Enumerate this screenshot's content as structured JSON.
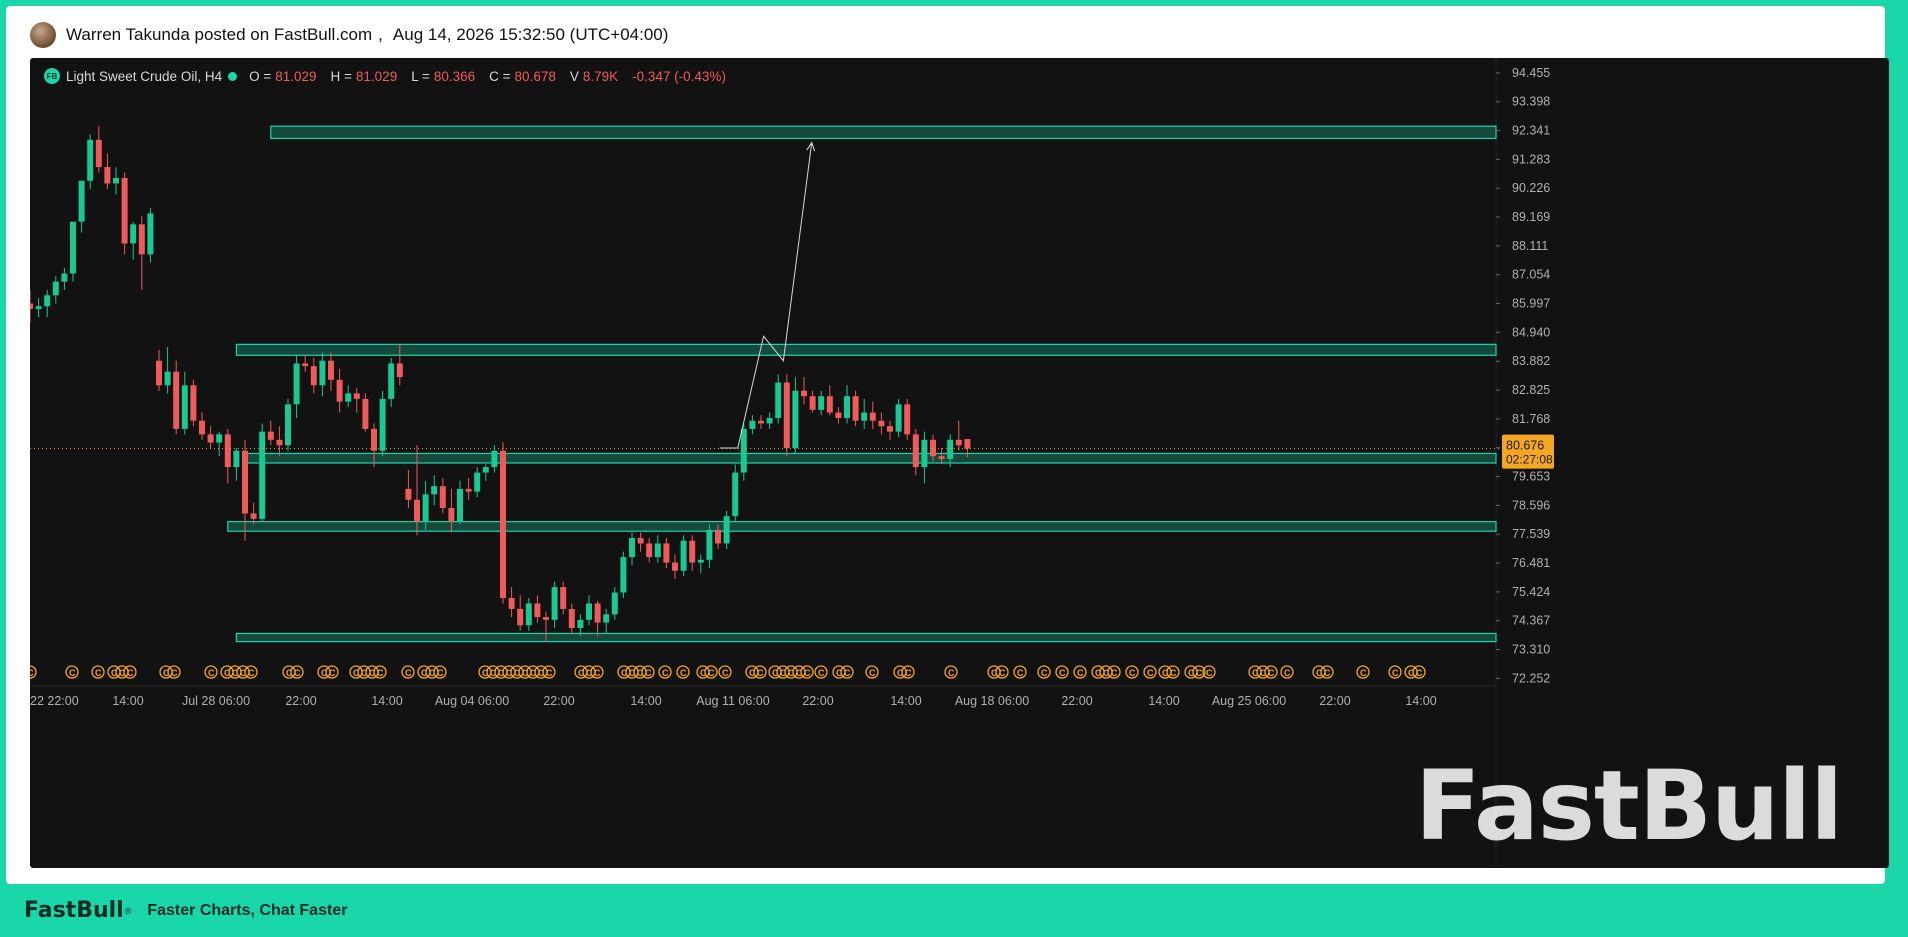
{
  "post": {
    "author": "Warren Takunda posted on FastBull.com",
    "separator": ",",
    "datetime": "Aug 14, 2026 15:32:50 (UTC+04:00)"
  },
  "legend": {
    "symbol": "Light Sweet Crude Oil, H4",
    "o_label": "O =",
    "o_value": "81.029",
    "h_label": "H =",
    "h_value": "81.029",
    "l_label": "L =",
    "l_value": "80.366",
    "c_label": "C =",
    "c_value": "80.678",
    "v_label": "V",
    "v_value": "8.79K",
    "change": "-0.347 (-0.43%)"
  },
  "watermark": "FastBull",
  "footer": {
    "brand": "FastBull",
    "reg": "®",
    "slogan": "Faster Charts, Chat Faster"
  },
  "colors": {
    "up": "#19c892",
    "down": "#f05a5a",
    "zone": "#19d7a8",
    "background": "#121212",
    "price_tag": "#f5a623",
    "event_icon": "#f5a623"
  },
  "chart_data": {
    "type": "candlestick",
    "y_ticks": [
      "94.455",
      "93.398",
      "92.341",
      "91.283",
      "90.226",
      "89.169",
      "88.111",
      "87.054",
      "85.997",
      "84.940",
      "83.882",
      "82.825",
      "81.768",
      "80.711",
      "79.653",
      "78.596",
      "77.539",
      "76.481",
      "75.424",
      "74.367",
      "73.310",
      "72.252"
    ],
    "x_ticks": [
      "22 22:00",
      "14:00",
      "Jul 28 06:00",
      "22:00",
      "14:00",
      "Aug 04 06:00",
      "22:00",
      "14:00",
      "Aug 11 06:00",
      "22:00",
      "14:00",
      "Aug 18 06:00",
      "22:00",
      "14:00",
      "Aug 25 06:00",
      "22:00",
      "14:00"
    ],
    "ylim": [
      71.9,
      95.0
    ],
    "last_price": {
      "value": "80.676",
      "countdown": "02:27:08"
    },
    "zones": [
      {
        "from_index": 28,
        "y_top": 92.5,
        "y_bottom": 92.05
      },
      {
        "from_index": 24,
        "y_top": 84.5,
        "y_bottom": 84.1
      },
      {
        "from_index": 25,
        "y_top": 80.5,
        "y_bottom": 80.15
      },
      {
        "from_index": 23,
        "y_top": 78.0,
        "y_bottom": 77.65
      },
      {
        "from_index": 24,
        "y_top": 73.9,
        "y_bottom": 73.6
      }
    ],
    "projection_path": [
      [
        80.2,
        80.7
      ],
      [
        82.3,
        80.7
      ],
      [
        85.3,
        84.8
      ],
      [
        87.6,
        83.9
      ],
      [
        90.9,
        91.9
      ]
    ],
    "candles": [
      {
        "o": 86.0,
        "h": 86.5,
        "l": 85.3,
        "c": 85.8
      },
      {
        "o": 85.8,
        "h": 86.2,
        "l": 85.5,
        "c": 85.9
      },
      {
        "o": 85.9,
        "h": 86.5,
        "l": 85.5,
        "c": 86.3
      },
      {
        "o": 86.3,
        "h": 87.0,
        "l": 86.0,
        "c": 86.8
      },
      {
        "o": 86.8,
        "h": 87.3,
        "l": 86.5,
        "c": 87.1
      },
      {
        "o": 87.1,
        "h": 88.5,
        "l": 86.8,
        "c": 89.0
      },
      {
        "o": 89.0,
        "h": 90.3,
        "l": 88.6,
        "c": 90.5
      },
      {
        "o": 90.5,
        "h": 92.2,
        "l": 90.2,
        "c": 92.0
      },
      {
        "o": 92.0,
        "h": 92.5,
        "l": 90.8,
        "c": 91.0
      },
      {
        "o": 91.0,
        "h": 91.5,
        "l": 90.2,
        "c": 90.4
      },
      {
        "o": 90.4,
        "h": 91.0,
        "l": 90.0,
        "c": 90.6
      },
      {
        "o": 90.6,
        "h": 90.8,
        "l": 87.8,
        "c": 88.2
      },
      {
        "o": 88.2,
        "h": 89.0,
        "l": 87.6,
        "c": 88.9
      },
      {
        "o": 88.9,
        "h": 89.2,
        "l": 86.5,
        "c": 87.8
      },
      {
        "o": 87.8,
        "h": 89.5,
        "l": 87.5,
        "c": 89.3
      },
      {
        "o": 83.9,
        "h": 84.3,
        "l": 82.8,
        "c": 83.0
      },
      {
        "o": 83.0,
        "h": 84.4,
        "l": 82.7,
        "c": 83.5
      },
      {
        "o": 83.5,
        "h": 83.9,
        "l": 81.2,
        "c": 81.4
      },
      {
        "o": 81.4,
        "h": 83.5,
        "l": 81.2,
        "c": 83.0
      },
      {
        "o": 83.0,
        "h": 83.2,
        "l": 81.5,
        "c": 81.7
      },
      {
        "o": 81.7,
        "h": 82.0,
        "l": 81.0,
        "c": 81.2
      },
      {
        "o": 81.2,
        "h": 81.5,
        "l": 80.7,
        "c": 80.9
      },
      {
        "o": 80.9,
        "h": 81.3,
        "l": 80.4,
        "c": 81.2
      },
      {
        "o": 81.2,
        "h": 81.4,
        "l": 79.4,
        "c": 80.0
      },
      {
        "o": 80.0,
        "h": 80.7,
        "l": 79.5,
        "c": 80.6
      },
      {
        "o": 80.6,
        "h": 81.0,
        "l": 77.3,
        "c": 78.3
      },
      {
        "o": 78.3,
        "h": 78.7,
        "l": 77.9,
        "c": 78.1
      },
      {
        "o": 78.1,
        "h": 81.6,
        "l": 78.0,
        "c": 81.3
      },
      {
        "o": 81.3,
        "h": 81.7,
        "l": 80.8,
        "c": 81.0
      },
      {
        "o": 81.0,
        "h": 81.5,
        "l": 80.4,
        "c": 80.8
      },
      {
        "o": 80.8,
        "h": 82.5,
        "l": 80.6,
        "c": 82.3
      },
      {
        "o": 82.3,
        "h": 84.1,
        "l": 81.8,
        "c": 83.8
      },
      {
        "o": 83.8,
        "h": 84.1,
        "l": 83.5,
        "c": 83.7
      },
      {
        "o": 83.7,
        "h": 84.0,
        "l": 82.7,
        "c": 83.0
      },
      {
        "o": 83.0,
        "h": 84.2,
        "l": 82.6,
        "c": 83.9
      },
      {
        "o": 83.9,
        "h": 84.2,
        "l": 82.8,
        "c": 83.2
      },
      {
        "o": 83.2,
        "h": 83.6,
        "l": 82.0,
        "c": 82.4
      },
      {
        "o": 82.4,
        "h": 83.0,
        "l": 82.2,
        "c": 82.7
      },
      {
        "o": 82.7,
        "h": 82.9,
        "l": 82.0,
        "c": 82.5
      },
      {
        "o": 82.5,
        "h": 82.7,
        "l": 81.3,
        "c": 81.4
      },
      {
        "o": 81.4,
        "h": 81.6,
        "l": 80.0,
        "c": 80.6
      },
      {
        "o": 80.6,
        "h": 82.8,
        "l": 80.4,
        "c": 82.5
      },
      {
        "o": 82.5,
        "h": 84.0,
        "l": 82.2,
        "c": 83.8
      },
      {
        "o": 83.8,
        "h": 84.5,
        "l": 83.0,
        "c": 83.3
      },
      {
        "o": 79.2,
        "h": 79.9,
        "l": 78.5,
        "c": 78.8
      },
      {
        "o": 78.8,
        "h": 80.8,
        "l": 77.5,
        "c": 78.0
      },
      {
        "o": 78.0,
        "h": 79.5,
        "l": 77.7,
        "c": 79.0
      },
      {
        "o": 79.0,
        "h": 79.7,
        "l": 78.6,
        "c": 79.3
      },
      {
        "o": 79.3,
        "h": 79.6,
        "l": 78.3,
        "c": 78.5
      },
      {
        "o": 78.5,
        "h": 79.2,
        "l": 77.6,
        "c": 78.0
      },
      {
        "o": 78.0,
        "h": 79.5,
        "l": 77.9,
        "c": 79.2
      },
      {
        "o": 79.2,
        "h": 79.6,
        "l": 78.8,
        "c": 79.1
      },
      {
        "o": 79.1,
        "h": 80.0,
        "l": 78.9,
        "c": 79.8
      },
      {
        "o": 79.8,
        "h": 80.1,
        "l": 79.5,
        "c": 80.0
      },
      {
        "o": 80.0,
        "h": 80.8,
        "l": 79.8,
        "c": 80.6
      },
      {
        "o": 80.6,
        "h": 80.9,
        "l": 75.0,
        "c": 75.2
      },
      {
        "o": 75.2,
        "h": 75.6,
        "l": 74.5,
        "c": 74.8
      },
      {
        "o": 74.8,
        "h": 75.3,
        "l": 74.0,
        "c": 74.2
      },
      {
        "o": 74.2,
        "h": 75.2,
        "l": 74.0,
        "c": 75.0
      },
      {
        "o": 75.0,
        "h": 75.3,
        "l": 74.3,
        "c": 74.5
      },
      {
        "o": 74.5,
        "h": 74.7,
        "l": 73.6,
        "c": 74.4
      },
      {
        "o": 74.4,
        "h": 75.8,
        "l": 74.1,
        "c": 75.6
      },
      {
        "o": 75.6,
        "h": 75.8,
        "l": 74.6,
        "c": 74.8
      },
      {
        "o": 74.8,
        "h": 75.0,
        "l": 73.9,
        "c": 74.1
      },
      {
        "o": 74.1,
        "h": 74.6,
        "l": 73.8,
        "c": 74.4
      },
      {
        "o": 74.4,
        "h": 75.3,
        "l": 74.2,
        "c": 75.0
      },
      {
        "o": 75.0,
        "h": 75.1,
        "l": 73.8,
        "c": 74.3
      },
      {
        "o": 74.3,
        "h": 74.8,
        "l": 73.9,
        "c": 74.6
      },
      {
        "o": 74.6,
        "h": 75.6,
        "l": 74.4,
        "c": 75.4
      },
      {
        "o": 75.4,
        "h": 76.9,
        "l": 75.2,
        "c": 76.7
      },
      {
        "o": 76.7,
        "h": 77.6,
        "l": 76.4,
        "c": 77.4
      },
      {
        "o": 77.4,
        "h": 77.6,
        "l": 76.9,
        "c": 77.2
      },
      {
        "o": 77.2,
        "h": 77.4,
        "l": 76.5,
        "c": 76.7
      },
      {
        "o": 76.7,
        "h": 77.5,
        "l": 76.5,
        "c": 77.2
      },
      {
        "o": 77.2,
        "h": 77.4,
        "l": 76.3,
        "c": 76.5
      },
      {
        "o": 76.5,
        "h": 76.8,
        "l": 75.9,
        "c": 76.2
      },
      {
        "o": 76.2,
        "h": 77.5,
        "l": 76.0,
        "c": 77.3
      },
      {
        "o": 77.3,
        "h": 77.5,
        "l": 76.2,
        "c": 76.5
      },
      {
        "o": 76.5,
        "h": 76.8,
        "l": 76.1,
        "c": 76.6
      },
      {
        "o": 76.6,
        "h": 77.9,
        "l": 76.3,
        "c": 77.7
      },
      {
        "o": 77.7,
        "h": 77.9,
        "l": 77.0,
        "c": 77.2
      },
      {
        "o": 77.2,
        "h": 78.4,
        "l": 77.0,
        "c": 78.2
      },
      {
        "o": 78.2,
        "h": 80.1,
        "l": 78.0,
        "c": 79.8
      },
      {
        "o": 79.8,
        "h": 81.6,
        "l": 79.5,
        "c": 81.4
      },
      {
        "o": 81.4,
        "h": 81.9,
        "l": 81.2,
        "c": 81.7
      },
      {
        "o": 81.7,
        "h": 81.9,
        "l": 81.4,
        "c": 81.6
      },
      {
        "o": 81.6,
        "h": 82.0,
        "l": 81.4,
        "c": 81.8
      },
      {
        "o": 81.8,
        "h": 83.4,
        "l": 81.6,
        "c": 83.1
      },
      {
        "o": 83.1,
        "h": 83.4,
        "l": 80.4,
        "c": 80.7
      },
      {
        "o": 80.7,
        "h": 83.3,
        "l": 80.5,
        "c": 82.8
      },
      {
        "o": 82.8,
        "h": 83.3,
        "l": 82.3,
        "c": 82.6
      },
      {
        "o": 82.6,
        "h": 82.8,
        "l": 82.0,
        "c": 82.1
      },
      {
        "o": 82.1,
        "h": 82.8,
        "l": 81.9,
        "c": 82.6
      },
      {
        "o": 82.6,
        "h": 83.0,
        "l": 81.9,
        "c": 82.0
      },
      {
        "o": 82.0,
        "h": 82.2,
        "l": 81.6,
        "c": 81.8
      },
      {
        "o": 81.8,
        "h": 83.0,
        "l": 81.6,
        "c": 82.6
      },
      {
        "o": 82.6,
        "h": 82.8,
        "l": 81.5,
        "c": 81.7
      },
      {
        "o": 81.7,
        "h": 82.5,
        "l": 81.4,
        "c": 82.0
      },
      {
        "o": 82.0,
        "h": 82.4,
        "l": 81.4,
        "c": 81.7
      },
      {
        "o": 81.7,
        "h": 82.0,
        "l": 81.2,
        "c": 81.5
      },
      {
        "o": 81.5,
        "h": 81.7,
        "l": 81.0,
        "c": 81.3
      },
      {
        "o": 81.3,
        "h": 82.5,
        "l": 81.1,
        "c": 82.3
      },
      {
        "o": 82.3,
        "h": 82.5,
        "l": 81.0,
        "c": 81.2
      },
      {
        "o": 81.2,
        "h": 81.4,
        "l": 79.7,
        "c": 80.0
      },
      {
        "o": 80.0,
        "h": 81.3,
        "l": 79.4,
        "c": 81.0
      },
      {
        "o": 81.0,
        "h": 81.2,
        "l": 80.2,
        "c": 80.4
      },
      {
        "o": 80.4,
        "h": 80.7,
        "l": 80.1,
        "c": 80.3
      },
      {
        "o": 80.3,
        "h": 81.2,
        "l": 80.0,
        "c": 81.0
      },
      {
        "o": 81.0,
        "h": 81.7,
        "l": 80.6,
        "c": 80.8
      },
      {
        "o": 81.029,
        "h": 81.029,
        "l": 80.366,
        "c": 80.678
      }
    ],
    "event_icon_x": [
      24,
      66,
      92,
      108,
      116,
      124,
      160,
      168,
      205,
      221,
      229,
      237,
      245,
      283,
      291,
      318,
      326,
      350,
      358,
      366,
      374,
      402,
      418,
      426,
      434,
      479,
      487,
      495,
      503,
      511,
      519,
      527,
      535,
      543,
      575,
      583,
      591,
      618,
      626,
      634,
      642,
      659,
      677,
      697,
      705,
      719,
      746,
      754,
      769,
      777,
      785,
      793,
      801,
      815,
      833,
      841,
      866,
      894,
      902,
      945,
      988,
      996,
      1014,
      1038,
      1056,
      1074,
      1092,
      1100,
      1108,
      1126,
      1144,
      1159,
      1167,
      1185,
      1193,
      1203,
      1249,
      1257,
      1265,
      1281,
      1313,
      1321,
      1357,
      1389,
      1405,
      1413
    ]
  }
}
